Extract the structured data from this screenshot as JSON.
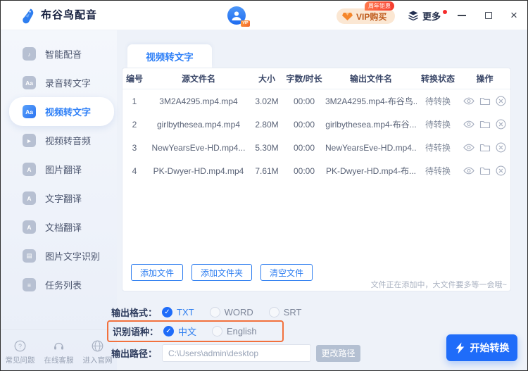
{
  "window": {
    "title": "布谷鸟配音",
    "vip": {
      "label": "VIP购买",
      "badge": "周年钜惠"
    },
    "more_label": "更多"
  },
  "sidebar": {
    "items": [
      {
        "label": "智能配音",
        "glyph": "♪"
      },
      {
        "label": "录音转文字",
        "glyph": "Aa"
      },
      {
        "label": "视频转文字",
        "glyph": "Aa",
        "active": true
      },
      {
        "label": "视频转音频",
        "glyph": "►"
      },
      {
        "label": "图片翻译",
        "glyph": "A"
      },
      {
        "label": "文字翻译",
        "glyph": "A"
      },
      {
        "label": "文档翻译",
        "glyph": "A"
      },
      {
        "label": "图片文字识别",
        "glyph": "▤"
      },
      {
        "label": "任务列表",
        "glyph": "≡"
      }
    ],
    "footer": [
      {
        "label": "常见问题"
      },
      {
        "label": "在线客服"
      },
      {
        "label": "进入官网"
      }
    ]
  },
  "main": {
    "tab_label": "视频转文字",
    "table": {
      "headers": [
        "编号",
        "源文件名",
        "大小",
        "字数/时长",
        "输出文件名",
        "转换状态",
        "操作"
      ],
      "rows": [
        {
          "index": "1",
          "source": "3M2A4295.mp4.mp4",
          "size": "3.02M",
          "duration": "00:00",
          "output": "3M2A4295.mp4-布谷鸟...",
          "status": "待转换"
        },
        {
          "index": "2",
          "source": "girlbythesea.mp4.mp4",
          "size": "2.80M",
          "duration": "00:00",
          "output": "girlbythesea.mp4-布谷...",
          "status": "待转换"
        },
        {
          "index": "3",
          "source": "NewYearsEve-HD.mp4...",
          "size": "5.30M",
          "duration": "00:00",
          "output": "NewYearsEve-HD.mp4...",
          "status": "待转换"
        },
        {
          "index": "4",
          "source": "PK-Dwyer-HD.mp4.mp4",
          "size": "7.61M",
          "duration": "00:00",
          "output": "PK-Dwyer-HD.mp4-布...",
          "status": "待转换"
        }
      ]
    },
    "actions": {
      "add_file": "添加文件",
      "add_folder": "添加文件夹",
      "clear": "清空文件"
    },
    "hint": "文件正在添加中，大文件要多等一会哦~",
    "format": {
      "label": "输出格式：",
      "options": [
        "TXT",
        "WORD",
        "SRT"
      ],
      "selected": "TXT"
    },
    "language": {
      "label": "识别语种：",
      "options": [
        "中文",
        "English"
      ],
      "selected": "中文"
    },
    "path": {
      "label": "输出路径：",
      "value": "C:\\Users\\admin\\desktop",
      "change": "更改路径"
    },
    "start_label": "开始转换"
  },
  "colors": {
    "accent": "#2e7ef0",
    "start_button": "#1f6cf9",
    "highlight_box": "#f2713d",
    "vip_pill_bg": "#fbe7d3",
    "vip_text": "#bf5c1d",
    "status_text": "#7e8798"
  }
}
